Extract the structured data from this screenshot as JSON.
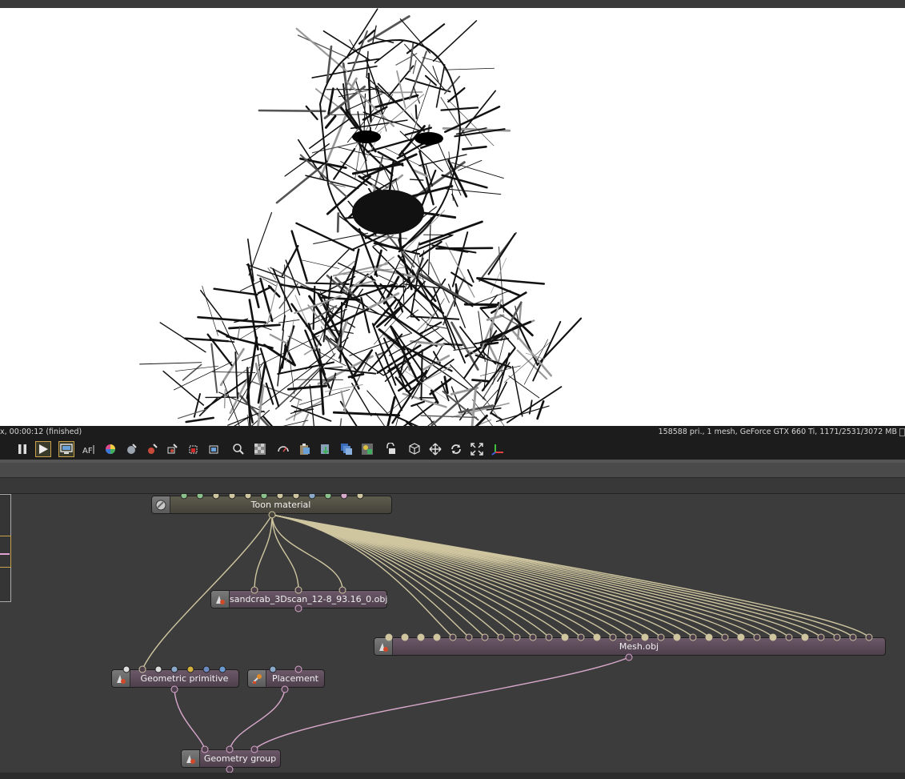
{
  "status": {
    "left_text": "x, 00:00:12 (finished)",
    "right_text": "158588 pri., 1 mesh, GeForce GTX 660 Ti, 1171/2531/3072 MB"
  },
  "toolbar": {
    "buttons": [
      {
        "name": "pause-button",
        "icon": "pause-icon"
      },
      {
        "name": "play-button",
        "icon": "play-icon",
        "active": true
      },
      {
        "name": "display-button",
        "icon": "monitor-icon",
        "active": true
      },
      {
        "name": "focus-button",
        "icon": "af-icon"
      },
      {
        "name": "color-picker-button",
        "icon": "color-wheel-icon"
      },
      {
        "name": "material-picker-button",
        "icon": "sphere-picker-icon"
      },
      {
        "name": "object-picker-button",
        "icon": "object-picker-icon"
      },
      {
        "name": "camera-picker-button",
        "icon": "camera-picker-icon"
      },
      {
        "name": "region-button",
        "icon": "region-icon"
      },
      {
        "name": "film-region-button",
        "icon": "film-region-icon"
      },
      {
        "name": "zoom-button",
        "icon": "magnifier-icon"
      },
      {
        "name": "pattern-button",
        "icon": "checker-icon"
      },
      {
        "name": "preferences-button",
        "icon": "gauge-icon"
      },
      {
        "name": "copy-button",
        "icon": "clipboard-icon"
      },
      {
        "name": "export-button",
        "icon": "export-icon"
      },
      {
        "name": "layers-button",
        "icon": "layers-icon"
      },
      {
        "name": "render-pass-button",
        "icon": "render-pass-icon"
      },
      {
        "name": "lock-button",
        "icon": "lock-icon"
      },
      {
        "name": "cube-button",
        "icon": "cube-icon"
      },
      {
        "name": "move-button",
        "icon": "move-icon"
      },
      {
        "name": "rotate-button",
        "icon": "rotate-icon"
      },
      {
        "name": "fit-button",
        "icon": "fit-icon"
      },
      {
        "name": "axis-button",
        "icon": "axis-icon"
      }
    ]
  },
  "graph": {
    "nodes": {
      "toon_material": {
        "label": "Toon material",
        "icon": "material-sphere-icon"
      },
      "sandcrab": {
        "label": "sandcrab_3Dscan_12-8_93.16_0.obj",
        "icon": "geometry-icon"
      },
      "mesh": {
        "label": "Mesh.obj",
        "icon": "geometry-icon"
      },
      "geometric_primitive": {
        "label": "Geometric primitive",
        "icon": "geometry-icon"
      },
      "placement": {
        "label": "Placement",
        "icon": "placement-icon"
      },
      "geometry_group": {
        "label": "Geometry group",
        "icon": "geometry-icon"
      }
    }
  },
  "colors": {
    "material_wire": "#cfc6a0",
    "geometry_wire": "#d8a8cc",
    "node_geometry": "#5a4a58",
    "node_material": "#4f4d42",
    "highlight": "#c8a24a"
  }
}
